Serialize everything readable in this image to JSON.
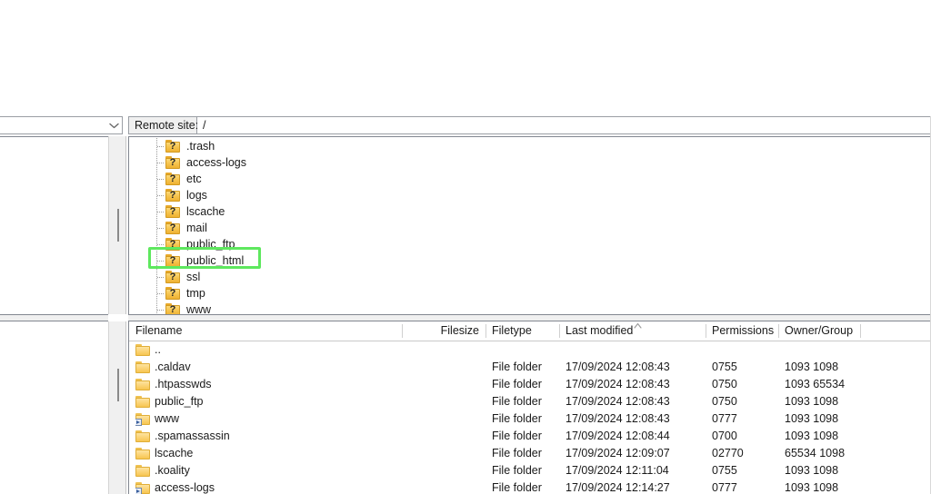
{
  "local_pane": {
    "site_combo": {
      "value": "",
      "chevron_icon": "chevron-down-icon"
    }
  },
  "remote_pane": {
    "site_bar": {
      "label": "Remote site:",
      "path": "/"
    },
    "tree": {
      "items": [
        {
          "label": ".trash",
          "icon": "folder-question-icon"
        },
        {
          "label": "access-logs",
          "icon": "folder-question-icon"
        },
        {
          "label": "etc",
          "icon": "folder-question-icon"
        },
        {
          "label": "logs",
          "icon": "folder-question-icon"
        },
        {
          "label": "lscache",
          "icon": "folder-question-icon"
        },
        {
          "label": "mail",
          "icon": "folder-question-icon"
        },
        {
          "label": "public_ftp",
          "icon": "folder-question-icon"
        },
        {
          "label": "public_html",
          "icon": "folder-question-icon",
          "highlighted": true
        },
        {
          "label": "ssl",
          "icon": "folder-question-icon"
        },
        {
          "label": "tmp",
          "icon": "folder-question-icon"
        },
        {
          "label": "www",
          "icon": "folder-question-icon"
        }
      ],
      "highlight_color": "#5ee85e"
    },
    "file_list": {
      "columns": [
        {
          "key": "filename",
          "label": "Filename"
        },
        {
          "key": "filesize",
          "label": "Filesize"
        },
        {
          "key": "filetype",
          "label": "Filetype"
        },
        {
          "key": "modified",
          "label": "Last modified",
          "sorted": true,
          "sort_dir": "asc"
        },
        {
          "key": "permissions",
          "label": "Permissions"
        },
        {
          "key": "owner",
          "label": "Owner/Group"
        }
      ],
      "rows": [
        {
          "filename": "..",
          "icon": "folder-icon",
          "filesize": "",
          "filetype": "",
          "modified": "",
          "permissions": "",
          "owner": ""
        },
        {
          "filename": ".caldav",
          "icon": "folder-icon",
          "filesize": "",
          "filetype": "File folder",
          "modified": "17/09/2024 12:08:43",
          "permissions": "0755",
          "owner": "1093 1098"
        },
        {
          "filename": ".htpasswds",
          "icon": "folder-icon",
          "filesize": "",
          "filetype": "File folder",
          "modified": "17/09/2024 12:08:43",
          "permissions": "0750",
          "owner": "1093 65534"
        },
        {
          "filename": "public_ftp",
          "icon": "folder-icon",
          "filesize": "",
          "filetype": "File folder",
          "modified": "17/09/2024 12:08:43",
          "permissions": "0750",
          "owner": "1093 1098"
        },
        {
          "filename": "www",
          "icon": "folder-symlink-icon",
          "filesize": "",
          "filetype": "File folder",
          "modified": "17/09/2024 12:08:43",
          "permissions": "0777",
          "owner": "1093 1098"
        },
        {
          "filename": ".spamassassin",
          "icon": "folder-icon",
          "filesize": "",
          "filetype": "File folder",
          "modified": "17/09/2024 12:08:44",
          "permissions": "0700",
          "owner": "1093 1098"
        },
        {
          "filename": "lscache",
          "icon": "folder-icon",
          "filesize": "",
          "filetype": "File folder",
          "modified": "17/09/2024 12:09:07",
          "permissions": "02770",
          "owner": "65534 1098"
        },
        {
          "filename": ".koality",
          "icon": "folder-icon",
          "filesize": "",
          "filetype": "File folder",
          "modified": "17/09/2024 12:11:04",
          "permissions": "0755",
          "owner": "1093 1098"
        },
        {
          "filename": "access-logs",
          "icon": "folder-symlink-icon",
          "filesize": "",
          "filetype": "File folder",
          "modified": "17/09/2024 12:14:27",
          "permissions": "0777",
          "owner": "1093 1098"
        }
      ]
    }
  }
}
